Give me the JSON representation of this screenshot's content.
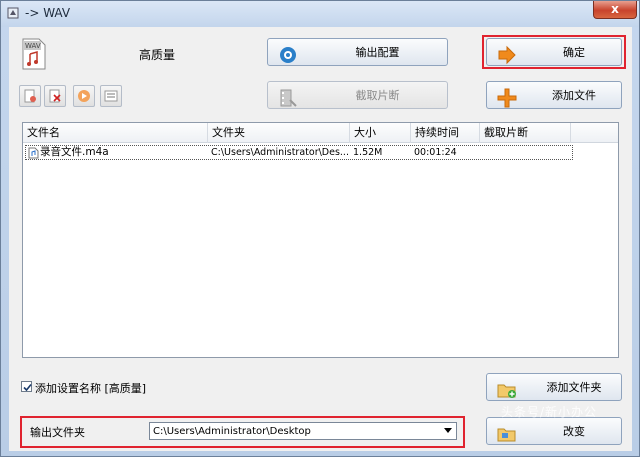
{
  "window": {
    "title": "-> WAV",
    "close_glyph": "x"
  },
  "header": {
    "quality_label": "高质量",
    "icon": "wav-file-icon"
  },
  "buttons": {
    "output_config": "输出配置",
    "ok": "确定",
    "clip": "截取片断",
    "add_file": "添加文件",
    "add_folder": "添加文件夹",
    "change": "改变"
  },
  "toolbar": {
    "icons": [
      "remove-icon",
      "delete-icon",
      "play-icon",
      "preview-icon"
    ]
  },
  "table": {
    "columns": [
      "文件名",
      "文件夹",
      "大小",
      "持续时间",
      "截取片断"
    ],
    "rows": [
      {
        "name": "录音文件.m4a",
        "folder": "C:\\Users\\Administrator\\Des...",
        "size": "1.52M",
        "duration": "00:01:24",
        "clip": ""
      }
    ]
  },
  "options": {
    "add_setting_name_label": "添加设置名称 [高质量]",
    "add_setting_name_checked": true
  },
  "output": {
    "label": "输出文件夹",
    "path": "C:\\Users\\Administrator\\Desktop"
  },
  "watermark": "头条号/新小办公",
  "colors": {
    "highlight": "#e0232f",
    "accent_orange": "#f08a1c",
    "window_frame": "#c5d7ee"
  }
}
